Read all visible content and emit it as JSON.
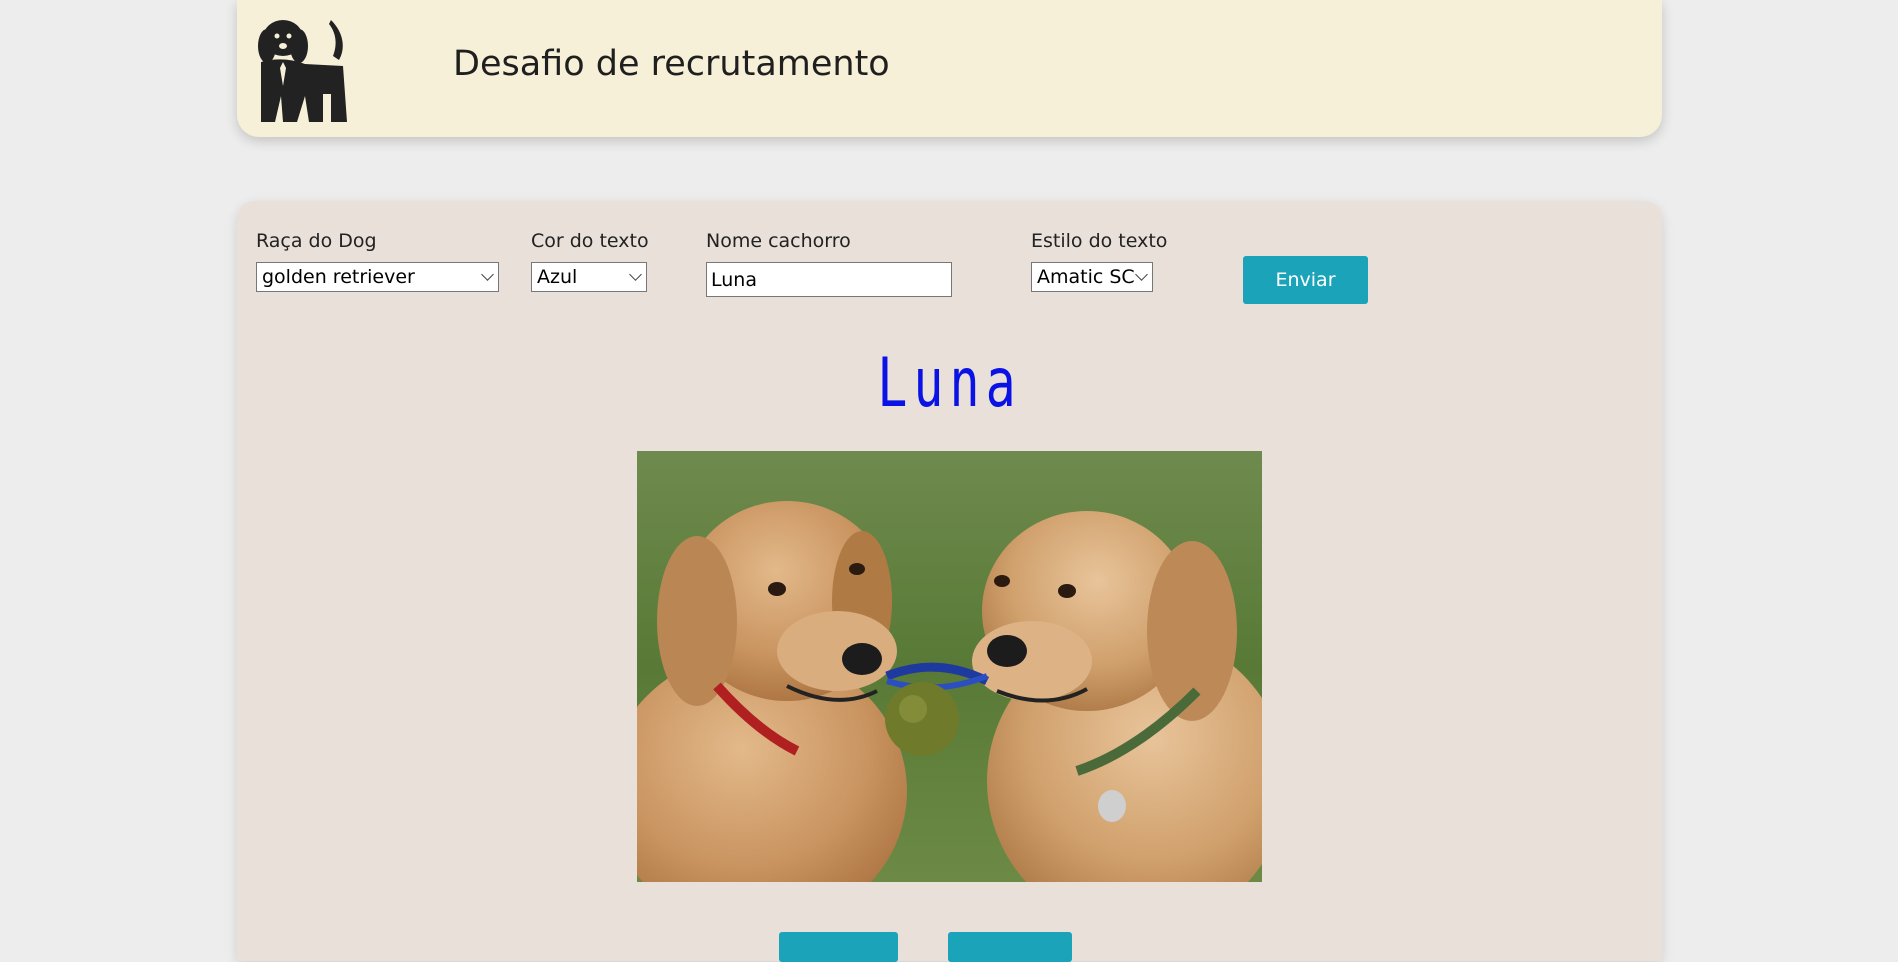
{
  "header": {
    "title": "Desafio de recrutamento",
    "logo_icon": "dog-logo-icon"
  },
  "form": {
    "breed": {
      "label": "Raça do Dog",
      "value": "golden retriever"
    },
    "color": {
      "label": "Cor do texto",
      "value": "Azul"
    },
    "name": {
      "label": "Nome cachorro",
      "value": "Luna"
    },
    "style": {
      "label": "Estilo do texto",
      "value": "Amatic SC"
    },
    "submit_label": "Enviar"
  },
  "result": {
    "dog_name": "Luna",
    "name_color": "#0a12e6",
    "image_icon": "golden-retriever-photo"
  },
  "colors": {
    "accent": "#1ba3b9",
    "header_bg": "#f7f0d8",
    "panel_bg": "#e8e0d9"
  }
}
